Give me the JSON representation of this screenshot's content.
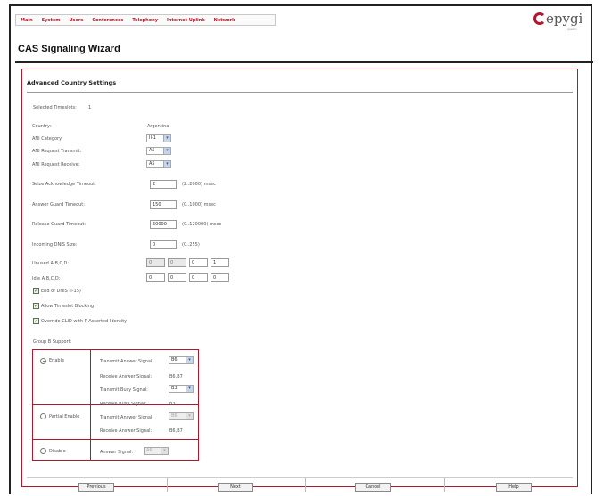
{
  "nav": [
    "Main",
    "System",
    "Users",
    "Conferences",
    "Telephony",
    "Internet Uplink",
    "Network"
  ],
  "logo": {
    "word": "epygi",
    "sub": "quadro"
  },
  "page_title": "CAS Signaling Wizard",
  "panel_title": "Advanced Country Settings",
  "selected_timeslots_label": "Selected Timeslots:",
  "selected_timeslots_value": "1",
  "country": {
    "label": "Country:",
    "value": "Argentina"
  },
  "ani_category": {
    "label": "ANI Category:",
    "value": "II-1"
  },
  "ani_transmit": {
    "label": "ANI Request Transmit:",
    "value": "A5"
  },
  "ani_receive": {
    "label": "ANI Request Receive:",
    "value": "A5"
  },
  "seize_ack": {
    "label": "Seize Acknowledge Timeout:",
    "value": "2",
    "range": "(2..2000) msec"
  },
  "answer_guard": {
    "label": "Answer Guard Timeout:",
    "value": "150",
    "range": "(0..1000) msec"
  },
  "release_guard": {
    "label": "Release Guard Timeout:",
    "value": "60000",
    "range": "(0..120000) msec"
  },
  "incoming_dnis": {
    "label": "Incoming DNIS Size:",
    "value": "0",
    "range": "(0..255)"
  },
  "unused_abcd": {
    "label": "Unused A,B,C,D:",
    "values": [
      "0",
      "0",
      "0",
      "1"
    ]
  },
  "idle_abcd": {
    "label": "Idle A,B,C,D:",
    "values": [
      "0",
      "0",
      "0",
      "0"
    ]
  },
  "checks": [
    "End of DNIS (I-15)",
    "Allow Timeslot Blocking",
    "Override CLID with P-Asserted-Identity"
  ],
  "group_b_label": "Group B Support:",
  "enable": {
    "label": "Enable",
    "transmit_answer_label": "Transmit Answer Signal:",
    "transmit_answer_value": "B6",
    "receive_answer_label": "Receive Answer Signal:",
    "receive_answer_value": "B6,B7",
    "transmit_busy_label": "Transmit Busy Signal:",
    "transmit_busy_value": "B3",
    "receive_busy_label": "Receive Busy Signal:",
    "receive_busy_value": "B3"
  },
  "partial": {
    "label": "Partial Enable",
    "transmit_answer_label": "Transmit Answer Signal:",
    "transmit_answer_value": "B6",
    "receive_answer_label": "Receive Answer Signal:",
    "receive_answer_value": "B6,B7"
  },
  "disable": {
    "label": "Disable",
    "answer_label": "Answer Signal:",
    "answer_value": "A6"
  },
  "footer": {
    "previous": "Previous",
    "next": "Next",
    "cancel": "Cancel",
    "help": "Help"
  }
}
